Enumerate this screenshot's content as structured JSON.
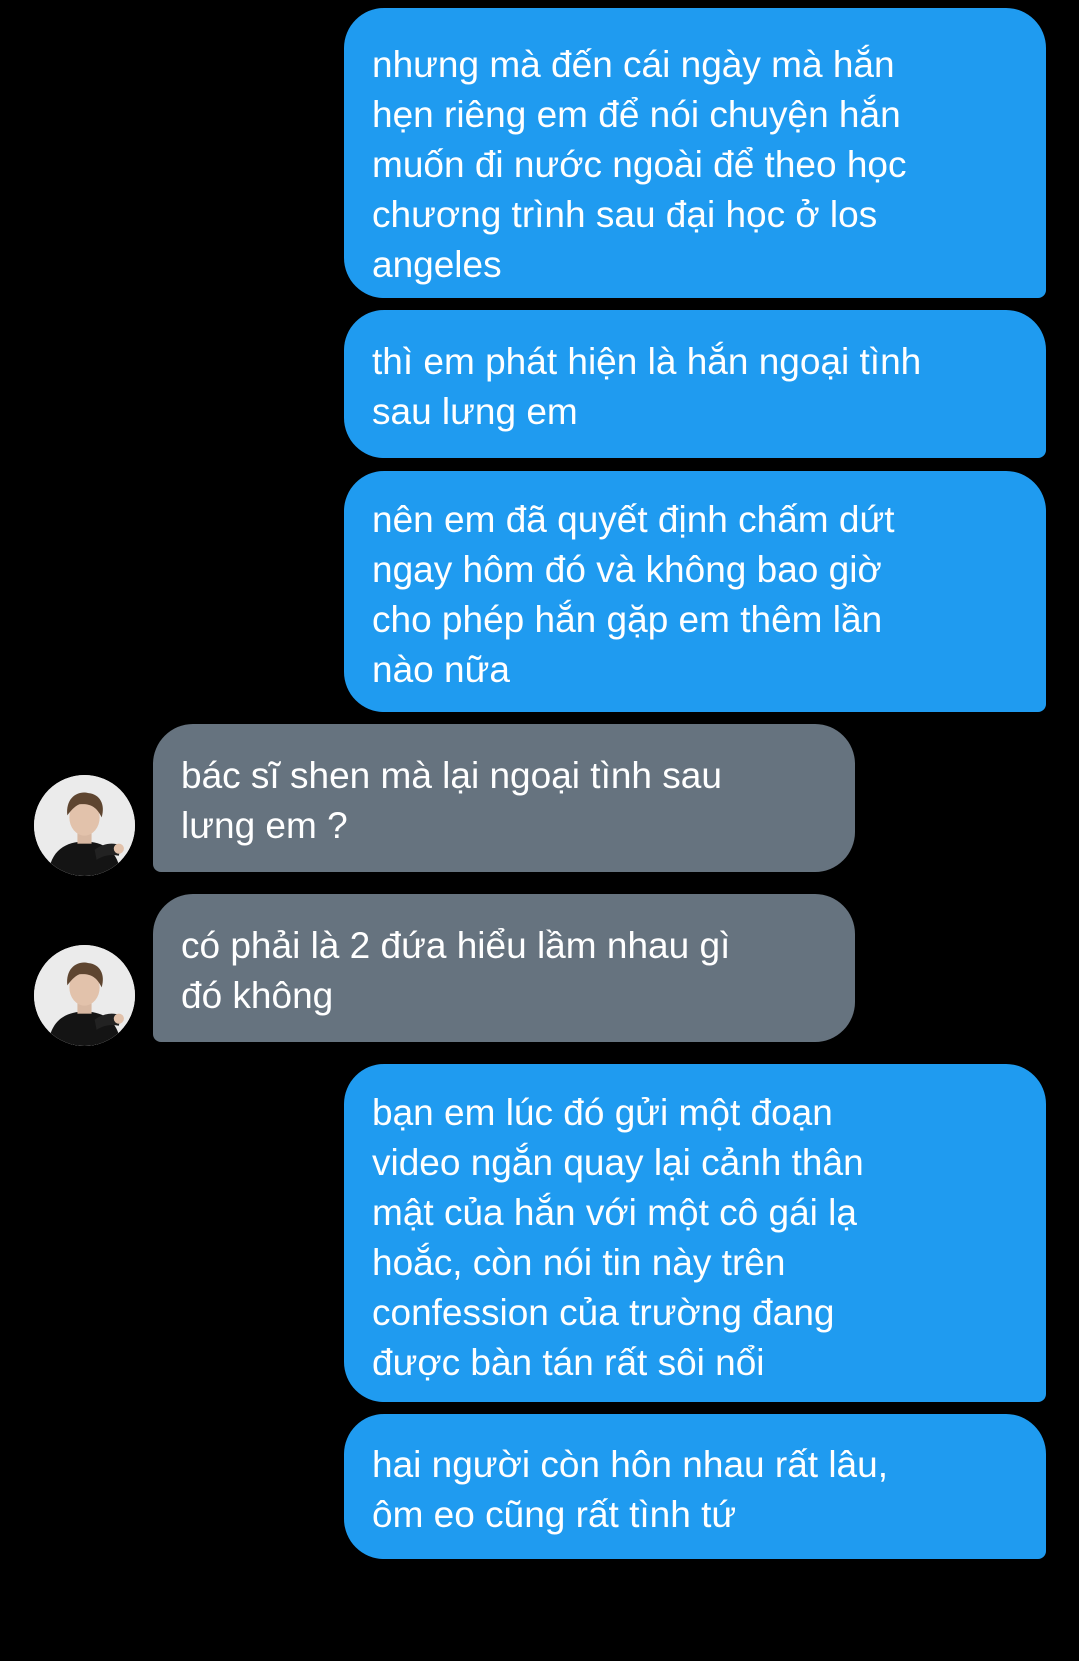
{
  "conversation": {
    "messages": [
      {
        "direction": "sent",
        "text": "nhưng mà đến cái ngày mà hắn\nhẹn riêng em để nói chuyện hắn\nmuốn đi nước ngoài để theo học\nchương trình sau đại học ở los\nangeles"
      },
      {
        "direction": "sent",
        "text": "thì em phát hiện là hắn ngoại tình\nsau lưng em"
      },
      {
        "direction": "sent",
        "text": "nên em đã quyết định chấm dứt\nngay hôm đó và không bao giờ\ncho phép hắn gặp em thêm lần\nnào nữa"
      },
      {
        "direction": "received",
        "text": "bác sĩ shen mà lại ngoại tình sau\nlưng em ?",
        "avatar_icon": "user-avatar"
      },
      {
        "direction": "received",
        "text": "có phải là 2 đứa hiểu lầm nhau gì\nđó không",
        "avatar_icon": "user-avatar"
      },
      {
        "direction": "sent",
        "text": "bạn em lúc đó gửi một đoạn\nvideo ngắn quay lại cảnh thân\nmật của hắn với một cô gái lạ\nhoắc, còn nói tin này trên\nconfession của trường đang\nđược bàn tán rất sôi nổi"
      },
      {
        "direction": "sent",
        "text": "hai người còn hôn nhau rất lâu,\nôm eo cũng rất tình tứ"
      }
    ]
  },
  "colors": {
    "background": "#000000",
    "sent_bubble": "#1f9bf0",
    "received_bubble": "#66737f",
    "text": "#ffffff"
  }
}
